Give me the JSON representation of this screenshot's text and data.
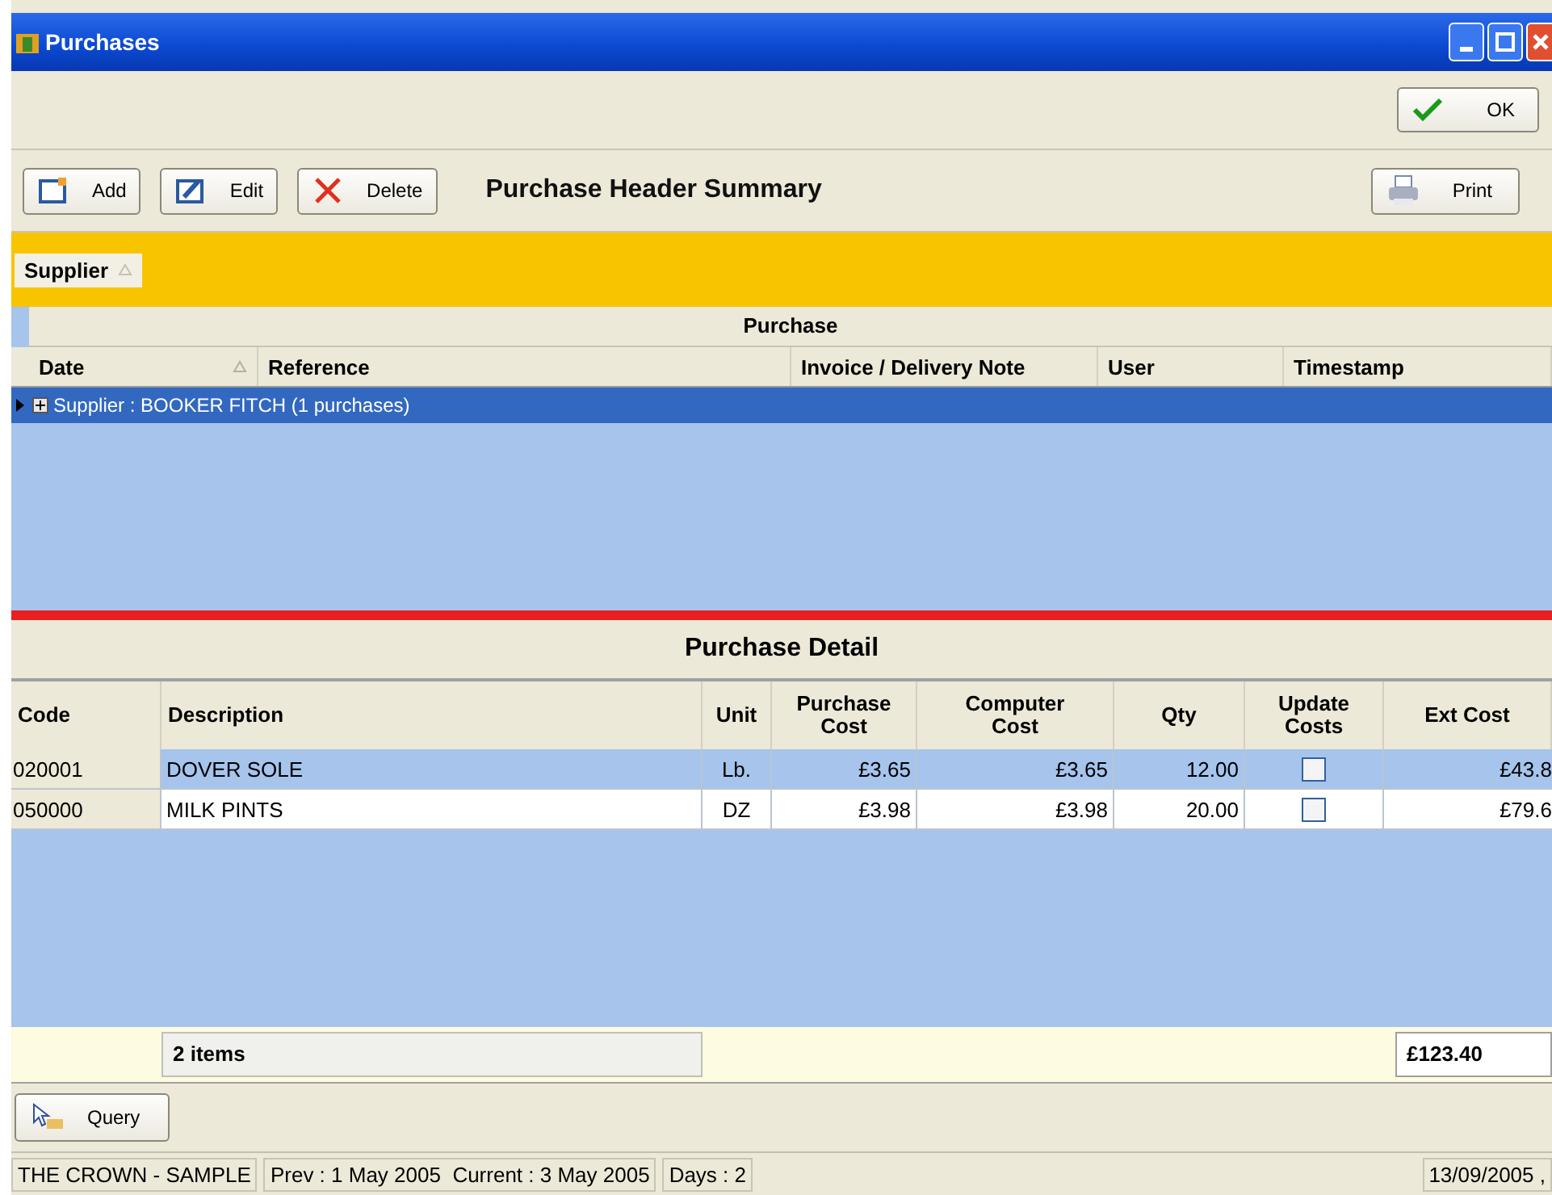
{
  "window": {
    "title": "Purchases"
  },
  "ok_button": {
    "label": "OK"
  },
  "toolbar": {
    "buttons": [
      {
        "label": "Add",
        "kind": "add"
      },
      {
        "label": "Edit",
        "kind": "edit"
      },
      {
        "label": "Delete",
        "kind": "delete"
      }
    ],
    "title": "Purchase Header Summary",
    "print": {
      "label": "Print"
    }
  },
  "group_by": [
    {
      "label": "Supplier"
    }
  ],
  "summary": {
    "band": "Purchase",
    "columns": [
      {
        "label": "Date",
        "sorted": true
      },
      {
        "label": "Reference",
        "sorted": false
      },
      {
        "label": "Invoice / Delivery Note",
        "sorted": false
      },
      {
        "label": "User",
        "sorted": false
      },
      {
        "label": "Timestamp",
        "sorted": false
      }
    ],
    "groups": [
      {
        "label": "Supplier : BOOKER FITCH (1 purchases)",
        "selected": true,
        "expanded": false
      }
    ]
  },
  "detail": {
    "title": "Purchase Detail",
    "columns": [
      "Code",
      "Description",
      "Unit",
      "Purchase Cost",
      "Computer Cost",
      "Qty",
      "Update Costs",
      "Ext Cost"
    ],
    "rows": [
      {
        "code": "020001",
        "description": "DOVER SOLE",
        "unit": "Lb.",
        "purchase_cost": "£3.65",
        "computer_cost": "£3.65",
        "qty": "12.00",
        "update_costs": false,
        "ext_cost": "£43.8",
        "selected": true
      },
      {
        "code": "050000",
        "description": "MILK PINTS",
        "unit": "DZ",
        "purchase_cost": "£3.98",
        "computer_cost": "£3.98",
        "qty": "20.00",
        "update_costs": false,
        "ext_cost": "£79.6",
        "selected": false
      }
    ],
    "footer": {
      "count": "2 items",
      "total": "£123.40"
    }
  },
  "query_button": {
    "label": "Query"
  },
  "status_bar": [
    "THE CROWN - SAMPLE",
    "Prev : 1 May 2005  Current : 3 May 2005",
    "Days : 2",
    "13/09/2005 ,"
  ]
}
